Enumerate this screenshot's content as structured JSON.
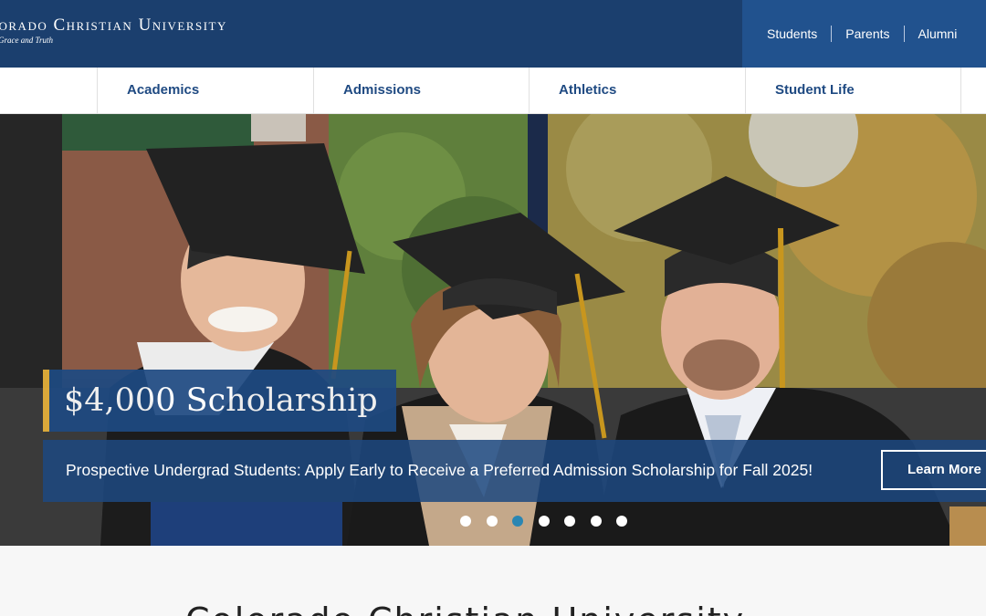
{
  "header": {
    "brand_name": "Colorado Christian University",
    "brand_tagline": "Grace and Truth",
    "audience_links": [
      "Students",
      "Parents",
      "Alumni"
    ]
  },
  "nav": {
    "items": [
      "Academics",
      "Admissions",
      "Athletics",
      "Student Life"
    ]
  },
  "hero": {
    "slide_title": "$4,000 Scholarship",
    "slide_text": "Prospective Undergrad Students: Apply Early to Receive a Preferred Admission Scholarship for Fall 2025!",
    "cta_label": "Learn More",
    "slide_count": 7,
    "active_slide": 3
  },
  "lower": {
    "heading": "Colorado Christian University"
  },
  "colors": {
    "header_bg": "#1b3f6e",
    "audience_bg": "#21528e",
    "nav_text": "#1f4a82",
    "accent_gold": "#e8b23a",
    "dot_active": "#2a86b3"
  }
}
